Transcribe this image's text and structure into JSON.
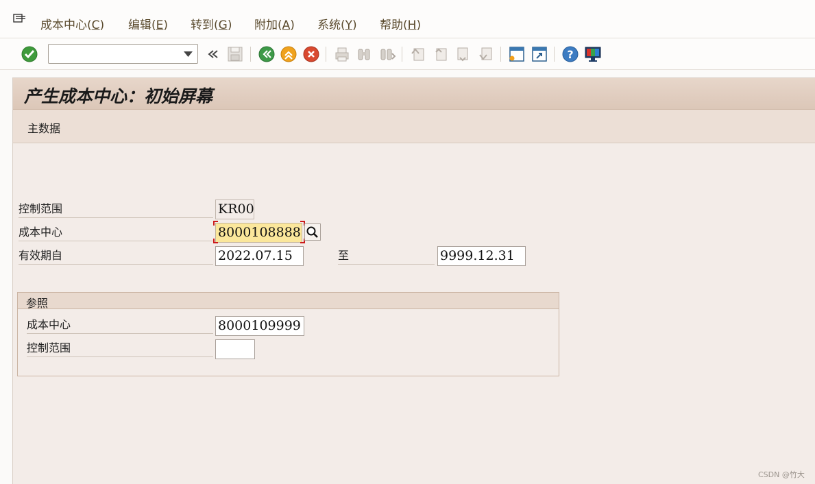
{
  "menu": {
    "items": [
      {
        "label": "成本中心(",
        "key": "C",
        "close": ")"
      },
      {
        "label": "编辑(",
        "key": "E",
        "close": ")"
      },
      {
        "label": "转到(",
        "key": "G",
        "close": ")"
      },
      {
        "label": "附加(",
        "key": "A",
        "close": ")"
      },
      {
        "label": "系统(",
        "key": "Y",
        "close": ")"
      },
      {
        "label": "帮助(",
        "key": "H",
        "close": ")"
      }
    ]
  },
  "toolbar": {
    "command_value": "",
    "icons": [
      "check-icon",
      "back-arrows-icon",
      "save-icon",
      "back-icon",
      "exit-icon",
      "cancel-icon",
      "print-icon",
      "find-icon",
      "find-next-icon",
      "first-page-icon",
      "previous-page-icon",
      "next-page-icon",
      "last-page-icon",
      "new-session-icon",
      "shortcut-icon",
      "help-icon",
      "customize-layout-icon"
    ]
  },
  "title": "产生成本中心：初始屏幕",
  "app_toolbar": {
    "master_data_label": "主数据"
  },
  "form": {
    "controlling_area_label": "控制范围",
    "controlling_area_value": "KR00",
    "cost_center_label": "成本中心",
    "cost_center_value": "8000108888",
    "valid_from_label": "有效期自",
    "valid_from_value": "2022.07.15",
    "to_label": "至",
    "valid_to_value": "9999.12.31"
  },
  "reference": {
    "title": "参照",
    "cost_center_label": "成本中心",
    "cost_center_value": "8000109999",
    "controlling_area_label": "控制范围",
    "controlling_area_value": ""
  },
  "watermark": "CSDN @竹大",
  "colors": {
    "title_bar": "#dcc7b8",
    "background": "#f3ece8",
    "focus_field": "#fbe79b",
    "menu_text": "#5a4a2d"
  }
}
